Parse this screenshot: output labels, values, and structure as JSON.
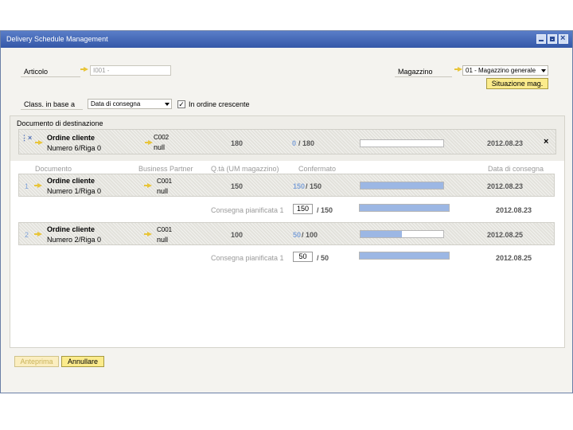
{
  "window": {
    "title": "Delivery Schedule Management"
  },
  "form": {
    "articolo_label": "Articolo",
    "articolo_value": "I001 -",
    "magazzino_label": "Magazzino",
    "magazzino_value": "01 - Magazzino generale",
    "situazione_button": "Situazione mag.",
    "class_label": "Class. in base a",
    "class_value": "Data di consegna",
    "crescente_label": "In ordine crescente",
    "crescente_checked": "✓"
  },
  "destination": {
    "section_label": "Documento di destinazione",
    "doc_type": "Ordine cliente",
    "doc_ref": "Numero 6/Riga 0",
    "bp_code": "C002",
    "bp_name": "null",
    "quantity": "180",
    "confirmed": "0",
    "total": "/ 180",
    "progress": 0,
    "date": "2012.08.23",
    "close": "×"
  },
  "table": {
    "columns": [
      "Documento",
      "Business Partner",
      "Q.tà (UM magazzino)",
      "Confermato",
      "Data di consegna"
    ],
    "rows": [
      {
        "num": "1",
        "doc_type": "Ordine cliente",
        "doc_ref": "Numero 1/Riga 0",
        "bp_code": "C001",
        "bp_name": "null",
        "quantity": "150",
        "confirmed": "150",
        "total": "/ 150",
        "progress": 1.0,
        "date": "2012.08.23",
        "sub_label": "Consegna pianificata 1",
        "sub_value": "150",
        "sub_total": "/ 150",
        "sub_progress": 1.0,
        "sub_date": "2012.08.23"
      },
      {
        "num": "2",
        "doc_type": "Ordine cliente",
        "doc_ref": "Numero 2/Riga 0",
        "bp_code": "C001",
        "bp_name": "null",
        "quantity": "100",
        "confirmed": "50",
        "total": "/ 100",
        "progress": 0.5,
        "date": "2012.08.25",
        "sub_label": "Consegna pianificata 1",
        "sub_value": "50",
        "sub_total": "/ 50",
        "sub_progress": 1.0,
        "sub_date": "2012.08.25"
      }
    ]
  },
  "footer": {
    "anteprima_button": "Anteprima",
    "annullare_button": "Annullare"
  },
  "colors": {
    "accent": "#9cb7e4",
    "button": "#fbeb8c",
    "titlebar": "#3457a8"
  }
}
